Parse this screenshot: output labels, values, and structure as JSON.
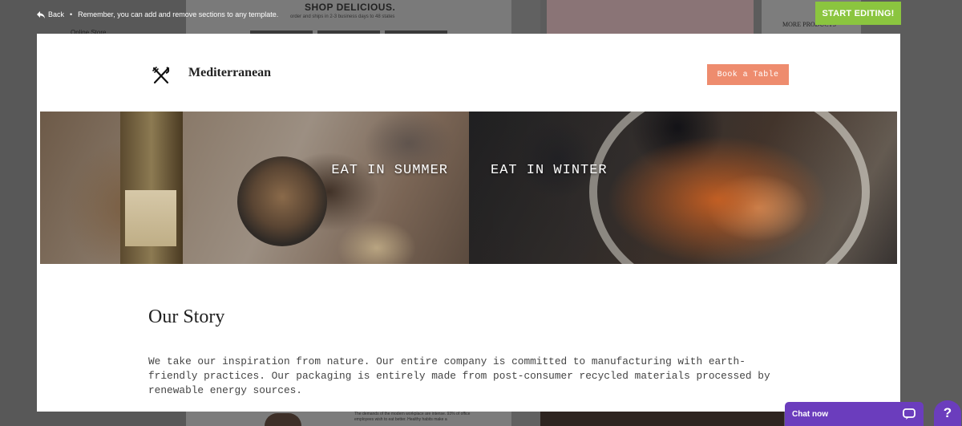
{
  "top_bar": {
    "back_label": "Back",
    "separator": "•",
    "notice": "Remember, you can add and remove sections to any template.",
    "start_editing": "START EDITING!"
  },
  "background": {
    "shop_title": "SHOP DELICIOUS.",
    "shop_subtitle": "order and ships in 2-3 business days to 48 states",
    "online_store": "Online Store",
    "more_products": "MORE PRODUCTS",
    "bottom_text": "The demands of the modern workplace are intense. 93% of office employees wish to eat better. Healthy habits make a"
  },
  "site": {
    "brand": "Mediterranean",
    "book_button": "Book a Table",
    "hero": {
      "left_title": "EAT IN SUMMER",
      "right_title": "EAT IN WINTER"
    },
    "story": {
      "title": "Our Story",
      "text": "We take our inspiration from nature. Our entire company is committed to manufacturing with earth-friendly practices. Our packaging is entirely made from post-consumer recycled materials processed by renewable energy sources."
    }
  },
  "chat": {
    "label": "Chat now",
    "help_symbol": "?"
  },
  "colors": {
    "accent_green": "#8bc53f",
    "book_button": "#ee8c6e",
    "chat_purple": "#6b3dbd"
  },
  "icons": [
    "back-arrow-icon",
    "fork-knife-icon",
    "chat-bubble-icon",
    "help-icon"
  ]
}
